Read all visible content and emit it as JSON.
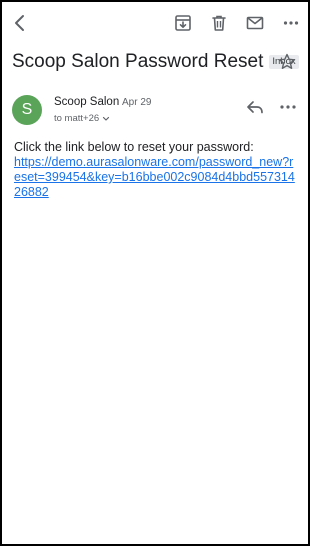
{
  "toolbar": {
    "back_icon": "chevron-left-icon",
    "archive_icon": "archive-icon",
    "delete_icon": "trash-icon",
    "mark_unread_icon": "envelope-icon",
    "more_icon": "more-horizontal-icon"
  },
  "message": {
    "subject": "Scoop Salon Password Reset",
    "label": "Inbox",
    "sender": {
      "initial": "S",
      "name": "Scoop Salon",
      "date": "Apr 29",
      "to": "to matt+26",
      "avatar_color": "#5aa45a"
    },
    "body_intro": "Click the link below to reset your password:",
    "reset_link": "https://demo.aurasalonware.com/password_new?reset=399454&key=b16bbe002c9084d4bbd55731426882"
  },
  "colors": {
    "link": "#1a73e8",
    "icon": "#5f6368"
  }
}
